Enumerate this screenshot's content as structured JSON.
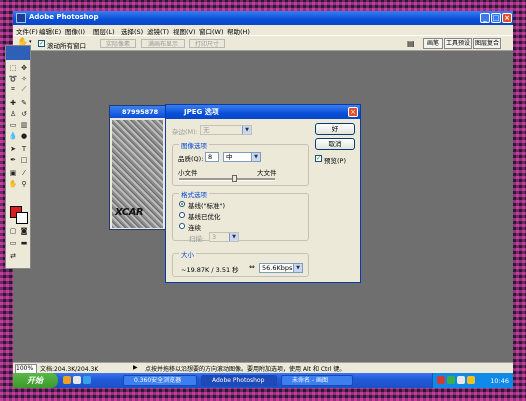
{
  "app": {
    "title": "Adobe Photoshop",
    "window_buttons": [
      "_",
      "□",
      "×"
    ]
  },
  "menu": [
    "文件(F)",
    "编辑(E)",
    "图像(I)",
    "图层(L)",
    "选择(S)",
    "滤镜(T)",
    "视图(V)",
    "窗口(W)",
    "帮助(H)"
  ],
  "options_bar": {
    "scroll_all_windows_label": "滚动所有窗口",
    "actual_pixels": "实际像素",
    "fit_on_screen": "满画布显示",
    "print_size": "打印尺寸",
    "tabs": [
      "画笔",
      "工具预设",
      "图层复合"
    ]
  },
  "document": {
    "title": "87995878",
    "watermark": "XCAR"
  },
  "dialog": {
    "title": "JPEG 选项",
    "matte_label": "杂边(M):",
    "matte_value": "无",
    "image_options_title": "图像选项",
    "quality_label": "品质(Q):",
    "quality_value": "8",
    "quality_level": "中",
    "small_file": "小文件",
    "large_file": "大文件",
    "format_options_title": "格式选项",
    "format_options": [
      "基线(\"标准\")",
      "基线已优化",
      "连续"
    ],
    "format_selected_index": 0,
    "scans_label": "扫描:",
    "scans_value": "3",
    "size_title": "大小",
    "size_value": "~19.87K / 3.51 秒",
    "speed_value": "56.6Kbps",
    "ok": "好",
    "cancel": "取消",
    "preview_label": "预览(P)",
    "preview_checked": true,
    "quality_slider_fraction": 0.57
  },
  "status": {
    "zoom": "100%",
    "doc": "文档:204.3K/204.3K",
    "hint": "点按并拖移以沿想要的方向滚动图像。要用附加选项，使用 Alt 和 Ctrl 键。"
  },
  "taskbar": {
    "start": "开始",
    "tasks": [
      "0.360安全浏览器",
      "Adobe Photoshop",
      "未命名 - 画图"
    ],
    "clock": "10:46"
  },
  "colors": {
    "foreground": "#d91f1f",
    "background": "#ffffff",
    "title_blue": "#0a4ed8"
  }
}
